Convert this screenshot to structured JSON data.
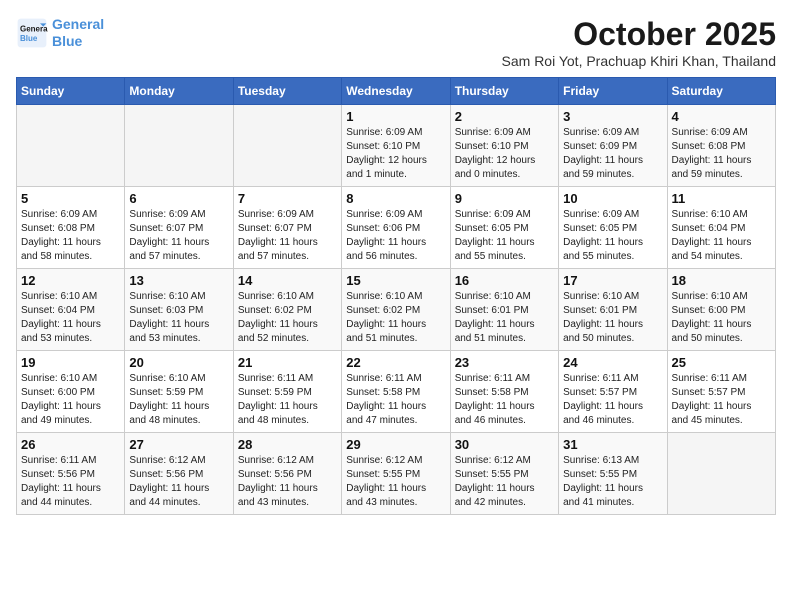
{
  "logo": {
    "line1": "General",
    "line2": "Blue"
  },
  "title": "October 2025",
  "location": "Sam Roi Yot, Prachuap Khiri Khan, Thailand",
  "weekdays": [
    "Sunday",
    "Monday",
    "Tuesday",
    "Wednesday",
    "Thursday",
    "Friday",
    "Saturday"
  ],
  "weeks": [
    [
      {
        "day": "",
        "info": ""
      },
      {
        "day": "",
        "info": ""
      },
      {
        "day": "",
        "info": ""
      },
      {
        "day": "1",
        "info": "Sunrise: 6:09 AM\nSunset: 6:10 PM\nDaylight: 12 hours\nand 1 minute."
      },
      {
        "day": "2",
        "info": "Sunrise: 6:09 AM\nSunset: 6:10 PM\nDaylight: 12 hours\nand 0 minutes."
      },
      {
        "day": "3",
        "info": "Sunrise: 6:09 AM\nSunset: 6:09 PM\nDaylight: 11 hours\nand 59 minutes."
      },
      {
        "day": "4",
        "info": "Sunrise: 6:09 AM\nSunset: 6:08 PM\nDaylight: 11 hours\nand 59 minutes."
      }
    ],
    [
      {
        "day": "5",
        "info": "Sunrise: 6:09 AM\nSunset: 6:08 PM\nDaylight: 11 hours\nand 58 minutes."
      },
      {
        "day": "6",
        "info": "Sunrise: 6:09 AM\nSunset: 6:07 PM\nDaylight: 11 hours\nand 57 minutes."
      },
      {
        "day": "7",
        "info": "Sunrise: 6:09 AM\nSunset: 6:07 PM\nDaylight: 11 hours\nand 57 minutes."
      },
      {
        "day": "8",
        "info": "Sunrise: 6:09 AM\nSunset: 6:06 PM\nDaylight: 11 hours\nand 56 minutes."
      },
      {
        "day": "9",
        "info": "Sunrise: 6:09 AM\nSunset: 6:05 PM\nDaylight: 11 hours\nand 55 minutes."
      },
      {
        "day": "10",
        "info": "Sunrise: 6:09 AM\nSunset: 6:05 PM\nDaylight: 11 hours\nand 55 minutes."
      },
      {
        "day": "11",
        "info": "Sunrise: 6:10 AM\nSunset: 6:04 PM\nDaylight: 11 hours\nand 54 minutes."
      }
    ],
    [
      {
        "day": "12",
        "info": "Sunrise: 6:10 AM\nSunset: 6:04 PM\nDaylight: 11 hours\nand 53 minutes."
      },
      {
        "day": "13",
        "info": "Sunrise: 6:10 AM\nSunset: 6:03 PM\nDaylight: 11 hours\nand 53 minutes."
      },
      {
        "day": "14",
        "info": "Sunrise: 6:10 AM\nSunset: 6:02 PM\nDaylight: 11 hours\nand 52 minutes."
      },
      {
        "day": "15",
        "info": "Sunrise: 6:10 AM\nSunset: 6:02 PM\nDaylight: 11 hours\nand 51 minutes."
      },
      {
        "day": "16",
        "info": "Sunrise: 6:10 AM\nSunset: 6:01 PM\nDaylight: 11 hours\nand 51 minutes."
      },
      {
        "day": "17",
        "info": "Sunrise: 6:10 AM\nSunset: 6:01 PM\nDaylight: 11 hours\nand 50 minutes."
      },
      {
        "day": "18",
        "info": "Sunrise: 6:10 AM\nSunset: 6:00 PM\nDaylight: 11 hours\nand 50 minutes."
      }
    ],
    [
      {
        "day": "19",
        "info": "Sunrise: 6:10 AM\nSunset: 6:00 PM\nDaylight: 11 hours\nand 49 minutes."
      },
      {
        "day": "20",
        "info": "Sunrise: 6:10 AM\nSunset: 5:59 PM\nDaylight: 11 hours\nand 48 minutes."
      },
      {
        "day": "21",
        "info": "Sunrise: 6:11 AM\nSunset: 5:59 PM\nDaylight: 11 hours\nand 48 minutes."
      },
      {
        "day": "22",
        "info": "Sunrise: 6:11 AM\nSunset: 5:58 PM\nDaylight: 11 hours\nand 47 minutes."
      },
      {
        "day": "23",
        "info": "Sunrise: 6:11 AM\nSunset: 5:58 PM\nDaylight: 11 hours\nand 46 minutes."
      },
      {
        "day": "24",
        "info": "Sunrise: 6:11 AM\nSunset: 5:57 PM\nDaylight: 11 hours\nand 46 minutes."
      },
      {
        "day": "25",
        "info": "Sunrise: 6:11 AM\nSunset: 5:57 PM\nDaylight: 11 hours\nand 45 minutes."
      }
    ],
    [
      {
        "day": "26",
        "info": "Sunrise: 6:11 AM\nSunset: 5:56 PM\nDaylight: 11 hours\nand 44 minutes."
      },
      {
        "day": "27",
        "info": "Sunrise: 6:12 AM\nSunset: 5:56 PM\nDaylight: 11 hours\nand 44 minutes."
      },
      {
        "day": "28",
        "info": "Sunrise: 6:12 AM\nSunset: 5:56 PM\nDaylight: 11 hours\nand 43 minutes."
      },
      {
        "day": "29",
        "info": "Sunrise: 6:12 AM\nSunset: 5:55 PM\nDaylight: 11 hours\nand 43 minutes."
      },
      {
        "day": "30",
        "info": "Sunrise: 6:12 AM\nSunset: 5:55 PM\nDaylight: 11 hours\nand 42 minutes."
      },
      {
        "day": "31",
        "info": "Sunrise: 6:13 AM\nSunset: 5:55 PM\nDaylight: 11 hours\nand 41 minutes."
      },
      {
        "day": "",
        "info": ""
      }
    ]
  ]
}
